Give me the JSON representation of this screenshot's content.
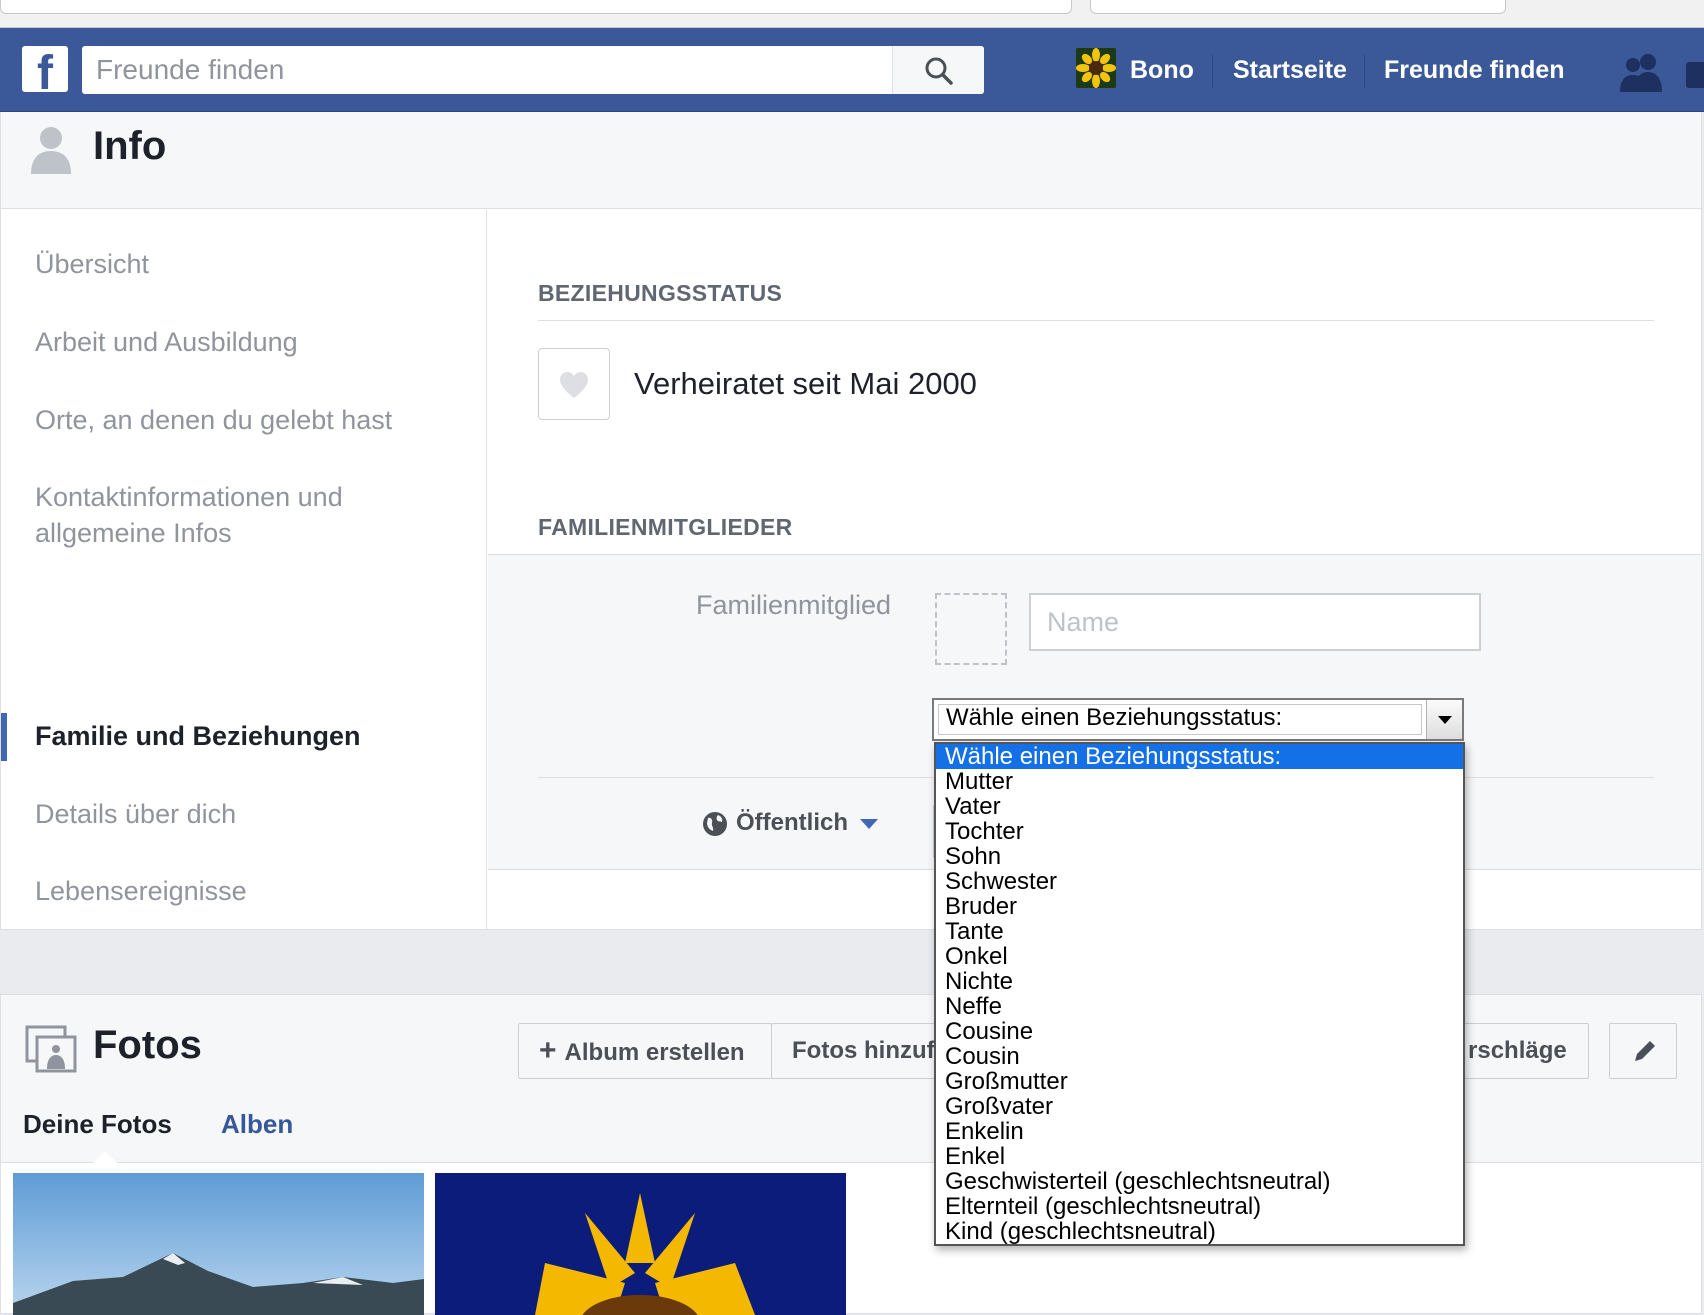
{
  "header": {
    "search_placeholder": "Freunde finden",
    "user_name": "Bono",
    "nav_home": "Startseite",
    "nav_find_friends": "Freunde finden",
    "brand_color": "#3b5998"
  },
  "info": {
    "title": "Info",
    "nav": [
      "Übersicht",
      "Arbeit und Ausbildung",
      "Orte, an denen du gelebt hast",
      "Kontaktinformationen und allgemeine Infos",
      "Familie und Beziehungen",
      "Details über dich",
      "Lebensereignisse"
    ],
    "active_nav": "Familie und Beziehungen"
  },
  "relationship": {
    "heading": "BEZIEHUNGSSTATUS",
    "status_text": "Verheiratet seit Mai 2000"
  },
  "family": {
    "heading": "FAMILIENMITGLIEDER",
    "member_label": "Familienmitglied",
    "name_placeholder": "Name",
    "privacy_label": "Öffentlich",
    "select_value": "Wähle einen Beziehungsstatus:",
    "options": [
      "Wähle einen Beziehungsstatus:",
      "Mutter",
      "Vater",
      "Tochter",
      "Sohn",
      "Schwester",
      "Bruder",
      "Tante",
      "Onkel",
      "Nichte",
      "Neffe",
      "Cousine",
      "Cousin",
      "Großmutter",
      "Großvater",
      "Enkelin",
      "Enkel",
      "Geschwisterteil (geschlechtsneutral)",
      "Elternteil (geschlechtsneutral)",
      "Kind (geschlechtsneutral)"
    ],
    "highlight_color": "#1470e7"
  },
  "photos": {
    "title": "Fotos",
    "create_album": "Album erstellen",
    "add_photos": "Fotos hinzuf",
    "suggestions": "rschläge",
    "tab_yours": "Deine Fotos",
    "tab_albums": "Alben"
  }
}
